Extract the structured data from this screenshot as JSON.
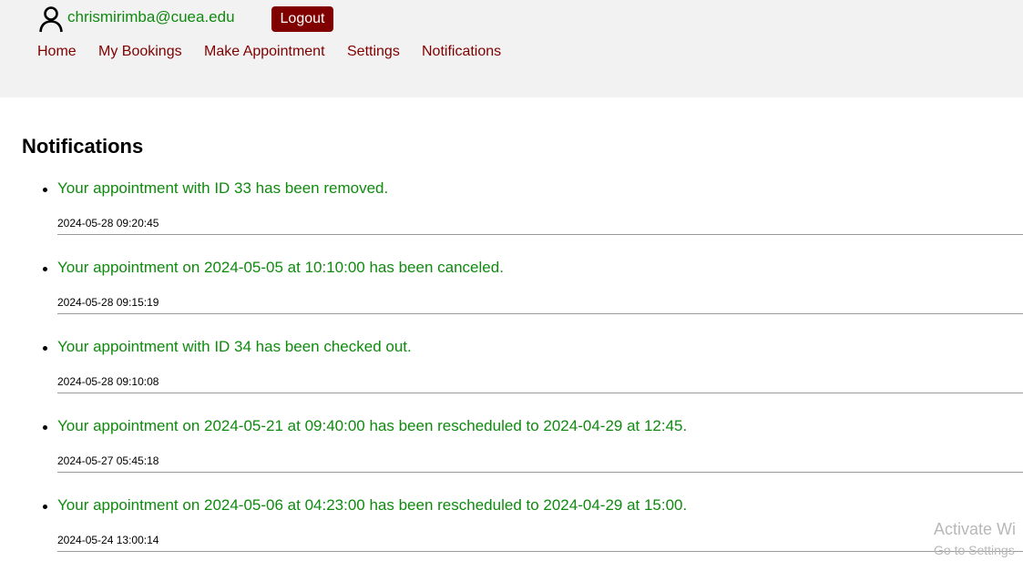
{
  "header": {
    "user_email": "chrismirimba@cuea.edu",
    "logout_label": "Logout",
    "nav": [
      {
        "label": "Home"
      },
      {
        "label": "My Bookings"
      },
      {
        "label": "Make Appointment"
      },
      {
        "label": "Settings"
      },
      {
        "label": "Notifications"
      }
    ]
  },
  "main": {
    "title": "Notifications",
    "notifications": [
      {
        "message": "Your appointment with ID 33 has been removed.",
        "time": "2024-05-28 09:20:45"
      },
      {
        "message": "Your appointment on 2024-05-05 at 10:10:00 has been canceled.",
        "time": "2024-05-28 09:15:19"
      },
      {
        "message": "Your appointment with ID 34 has been checked out.",
        "time": "2024-05-28 09:10:08"
      },
      {
        "message": "Your appointment on 2024-05-21 at 09:40:00 has been rescheduled to 2024-04-29 at 12:45.",
        "time": "2024-05-27 05:45:18"
      },
      {
        "message": "Your appointment on 2024-05-06 at 04:23:00 has been rescheduled to 2024-04-29 at 15:00.",
        "time": "2024-05-24 13:00:14"
      }
    ]
  },
  "watermark": {
    "title": "Activate Wi",
    "subtitle": "Go to Settings"
  },
  "colors": {
    "header_bg": "#f2f2f2",
    "nav_link": "#800000",
    "logout_bg": "#800000",
    "accent_green": "#0f8a0f"
  },
  "icons": {
    "user": "user-icon"
  }
}
